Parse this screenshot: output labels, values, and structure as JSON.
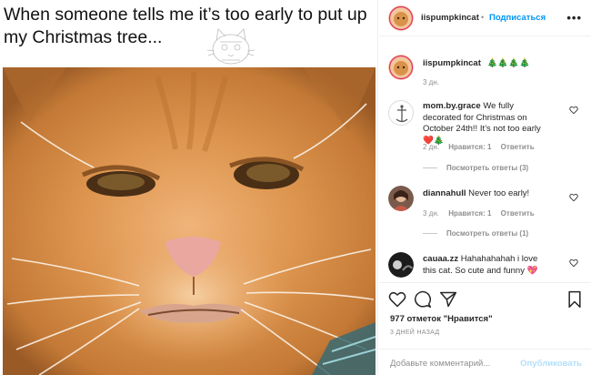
{
  "post": {
    "caption_text": "When someone tells me it’s too early to put up my Christmas tree..."
  },
  "header": {
    "username": "iispumpkincat",
    "separator": "•",
    "follow_label": "Подписаться",
    "more_label": "•••"
  },
  "caption_comment": {
    "username": "iispumpkincat",
    "text": "🎄🎄🎄🎄",
    "time": "3 дн."
  },
  "comments": [
    {
      "username": "mom.by.grace",
      "text": "We fully decorated for Christmas on October 24th!! It’s not too early ❤️🎄",
      "time": "2 дн.",
      "likes": "Нравится: 1",
      "reply": "Ответить",
      "view_replies": "Посмотреть ответы (3)"
    },
    {
      "username": "diannahull",
      "text": "Never too early!",
      "time": "3 дн.",
      "likes": "Нравится: 1",
      "reply": "Ответить",
      "view_replies": "Посмотреть ответы (1)"
    },
    {
      "username": "cauaa.zz",
      "text": "Hahahahahah i love this cat. So cute and funny 💖"
    }
  ],
  "actions": {
    "likes_text": "977 отметок \"Нравится\"",
    "date_text": "3 ДНЕЙ НАЗАД",
    "comment_placeholder": "Добавьте комментарий...",
    "publish_label": "Опубликовать"
  },
  "icons": {
    "like": "heart-icon",
    "comment": "comment-bubble-icon",
    "share": "paper-plane-icon",
    "save": "bookmark-icon",
    "more": "ellipsis-icon"
  },
  "colors": {
    "link_blue": "#0095f6",
    "muted": "#8e8e8e",
    "text": "#262626",
    "publish_disabled": "#b2dffc",
    "cat_fur": "#d9924a"
  }
}
